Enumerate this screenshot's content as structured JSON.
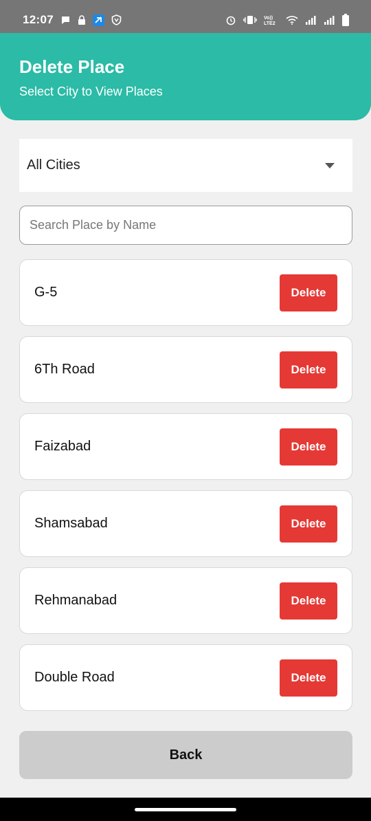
{
  "status_bar": {
    "time": "12:07",
    "left_icons": [
      "chat-bubble-icon",
      "lock-icon",
      "app-shortcut-icon",
      "shield-icon"
    ],
    "right_icons": [
      "alarm-icon",
      "vibrate-icon",
      "volte-icon",
      "wifi-icon",
      "signal-icon",
      "signal-icon",
      "battery-icon"
    ],
    "volte_label": "VoLTE2"
  },
  "header": {
    "title": "Delete Place",
    "subtitle": "Select City to View Places",
    "background_color": "#2bbba6"
  },
  "city_dropdown": {
    "selected": "All Cities"
  },
  "search": {
    "placeholder": "Search Place by Name",
    "value": ""
  },
  "places": [
    {
      "name": "G-5",
      "action": "Delete"
    },
    {
      "name": "6Th Road",
      "action": "Delete"
    },
    {
      "name": "Faizabad",
      "action": "Delete"
    },
    {
      "name": "Shamsabad",
      "action": "Delete"
    },
    {
      "name": "Rehmanabad",
      "action": "Delete"
    },
    {
      "name": "Double Road",
      "action": "Delete"
    }
  ],
  "delete_color": "#e53935",
  "back_button": {
    "label": "Back"
  }
}
